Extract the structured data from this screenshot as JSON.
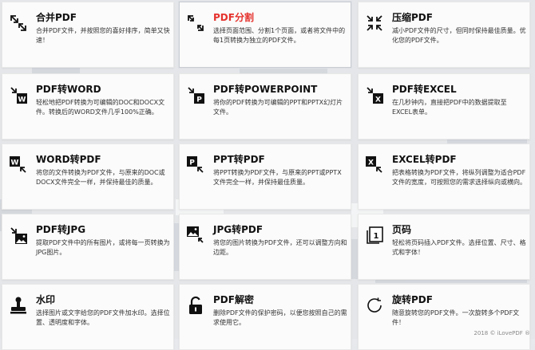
{
  "tools": [
    {
      "title": "合并PDF",
      "desc": "合并PDF文件，并按照您的喜好排序，简单又快速！",
      "icon": "merge-icon",
      "active": false
    },
    {
      "title": "PDF分割",
      "desc": "选择页面范围、分割1个页面，或者将文件中的每1页转换为独立的PDF文件。",
      "icon": "split-icon",
      "active": true
    },
    {
      "title": "压缩PDF",
      "desc": "减小PDF文件的尺寸，但同时保持最佳质量。优化您的PDF文件。",
      "icon": "compress-icon",
      "active": false
    },
    {
      "title": "PDF转WORD",
      "desc": "轻松地把PDF转换为可编辑的DOC和DOCX文件。转换后的WORD文件几乎100%正确。",
      "icon": "pdf-to-word-icon",
      "active": false
    },
    {
      "title": "PDF转POWERPOINT",
      "desc": "将你的PDF转换为可编辑的PPT和PPTX幻灯片文件。",
      "icon": "pdf-to-powerpoint-icon",
      "active": false
    },
    {
      "title": "PDF转EXCEL",
      "desc": "在几秒钟内，直接把PDF中的数据提取至EXCEL表单。",
      "icon": "pdf-to-excel-icon",
      "active": false
    },
    {
      "title": "WORD转PDF",
      "desc": "将您的文件转换为PDF文件，与原来的DOC或DOCX文件完全一样，并保持最佳的质量。",
      "icon": "word-to-pdf-icon",
      "active": false
    },
    {
      "title": "PPT转PDF",
      "desc": "将PPT转换为PDF文件，与原来的PPT或PPTX文件完全一样，并保持最佳质量。",
      "icon": "ppt-to-pdf-icon",
      "active": false
    },
    {
      "title": "EXCEL转PDF",
      "desc": "把表格转换为PDF文件，将纵列调整为适合PDF文件的宽度，可按照您的需求选择纵向或横向。",
      "icon": "excel-to-pdf-icon",
      "active": false
    },
    {
      "title": "PDF转JPG",
      "desc": "提取PDF文件中的所有图片，或将每一页转换为JPG图片。",
      "icon": "pdf-to-jpg-icon",
      "active": false
    },
    {
      "title": "JPG转PDF",
      "desc": "将您的图片转换为PDF文件，还可以调整方向和边距。",
      "icon": "jpg-to-pdf-icon",
      "active": false
    },
    {
      "title": "页码",
      "desc": "轻松将页码插入PDF文件。选择位置、尺寸、格式和字体！",
      "icon": "page-numbers-icon",
      "active": false
    },
    {
      "title": "水印",
      "desc": "选择图片或文字给您的PDF文件加水印。选择位置、透明度和字体。",
      "icon": "watermark-stamp-icon",
      "active": false
    },
    {
      "title": "PDF解密",
      "desc": "删除PDF文件的保护密码，以便您按照自己的需求使用它。",
      "icon": "unlock-icon",
      "active": false
    },
    {
      "title": "旋转PDF",
      "desc": "随意旋转您的PDF文件。一次旋转多个PDF文件！",
      "icon": "rotate-icon",
      "active": false
    }
  ],
  "footer": {
    "copyright": "2018 © iLovePDF ®"
  }
}
